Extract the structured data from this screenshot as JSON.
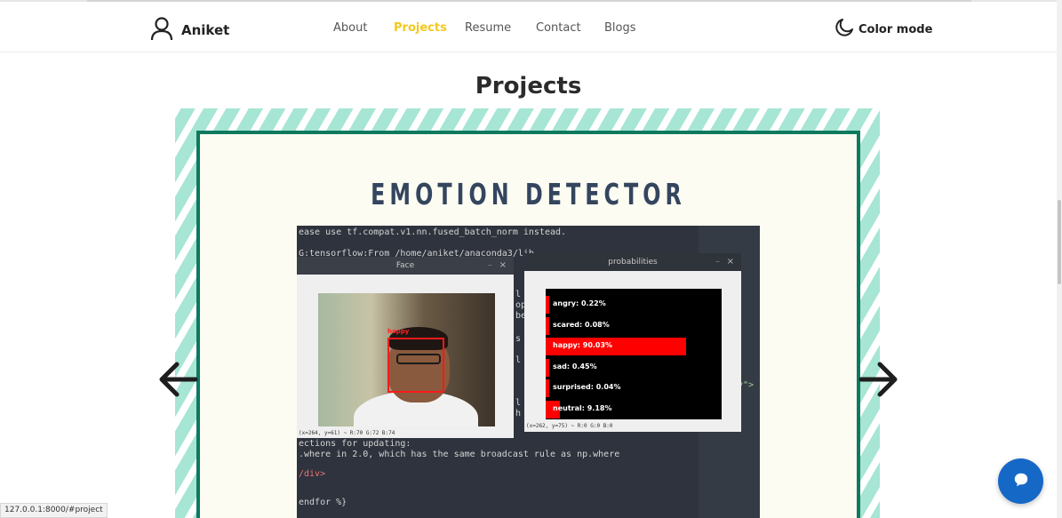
{
  "navbar": {
    "brand": "Aniket",
    "links": [
      {
        "label": "About",
        "active": false
      },
      {
        "label": "Projects",
        "active": true
      },
      {
        "label": "Resume",
        "active": false
      },
      {
        "label": "Contact",
        "active": false
      },
      {
        "label": "Blogs",
        "active": false
      }
    ],
    "color_mode_label": "Color mode"
  },
  "section": {
    "title": "Projects"
  },
  "project": {
    "title": "EMOTION DETECTOR",
    "screenshot": {
      "terminal_lines": [
        "ease use tf.compat.v1.nn.fused_batch_norm instead.",
        "G:tensorflow:From /home/aniket/anaconda3/lib",
        "l",
        "op",
        "be",
        "s",
        "l",
        "l",
        "h",
        "ections for updating:",
        ".where in 2.0, which has the same broadcast rule as np.where",
        "/div>",
        "endfor %}"
      ],
      "side_text": "y\">",
      "face_window_title": "Face",
      "face_tag": "happy",
      "face_coords": "(x=264, y=61) ~ R:70 G:72 B:74",
      "prob_window_title": "probabilities",
      "prob_coords": "(x=262, y=75) ~ R:0 G:0 B:0",
      "probabilities": [
        {
          "label": "angry: 0.22%",
          "value": 0.22
        },
        {
          "label": "scared: 0.08%",
          "value": 0.08
        },
        {
          "label": "happy: 90.03%",
          "value": 90.03
        },
        {
          "label": "sad: 0.45%",
          "value": 0.45
        },
        {
          "label": "surprised: 0.04%",
          "value": 0.04
        },
        {
          "label": "neutral: 9.18%",
          "value": 9.18
        }
      ]
    }
  },
  "status_bar": {
    "url": "127.0.0.1:8000/#project"
  },
  "colors": {
    "accent": "#f4c81b",
    "frame_border": "#0d7a5f",
    "stripe": "#a7e5d4",
    "chat_button": "#1668c7",
    "prob_bar": "#ff0000"
  },
  "icons": {
    "brand": "user-icon",
    "color_mode": "moon-icon",
    "prev": "arrow-left-icon",
    "next": "arrow-right-icon",
    "chat": "chat-bubble-icon"
  }
}
